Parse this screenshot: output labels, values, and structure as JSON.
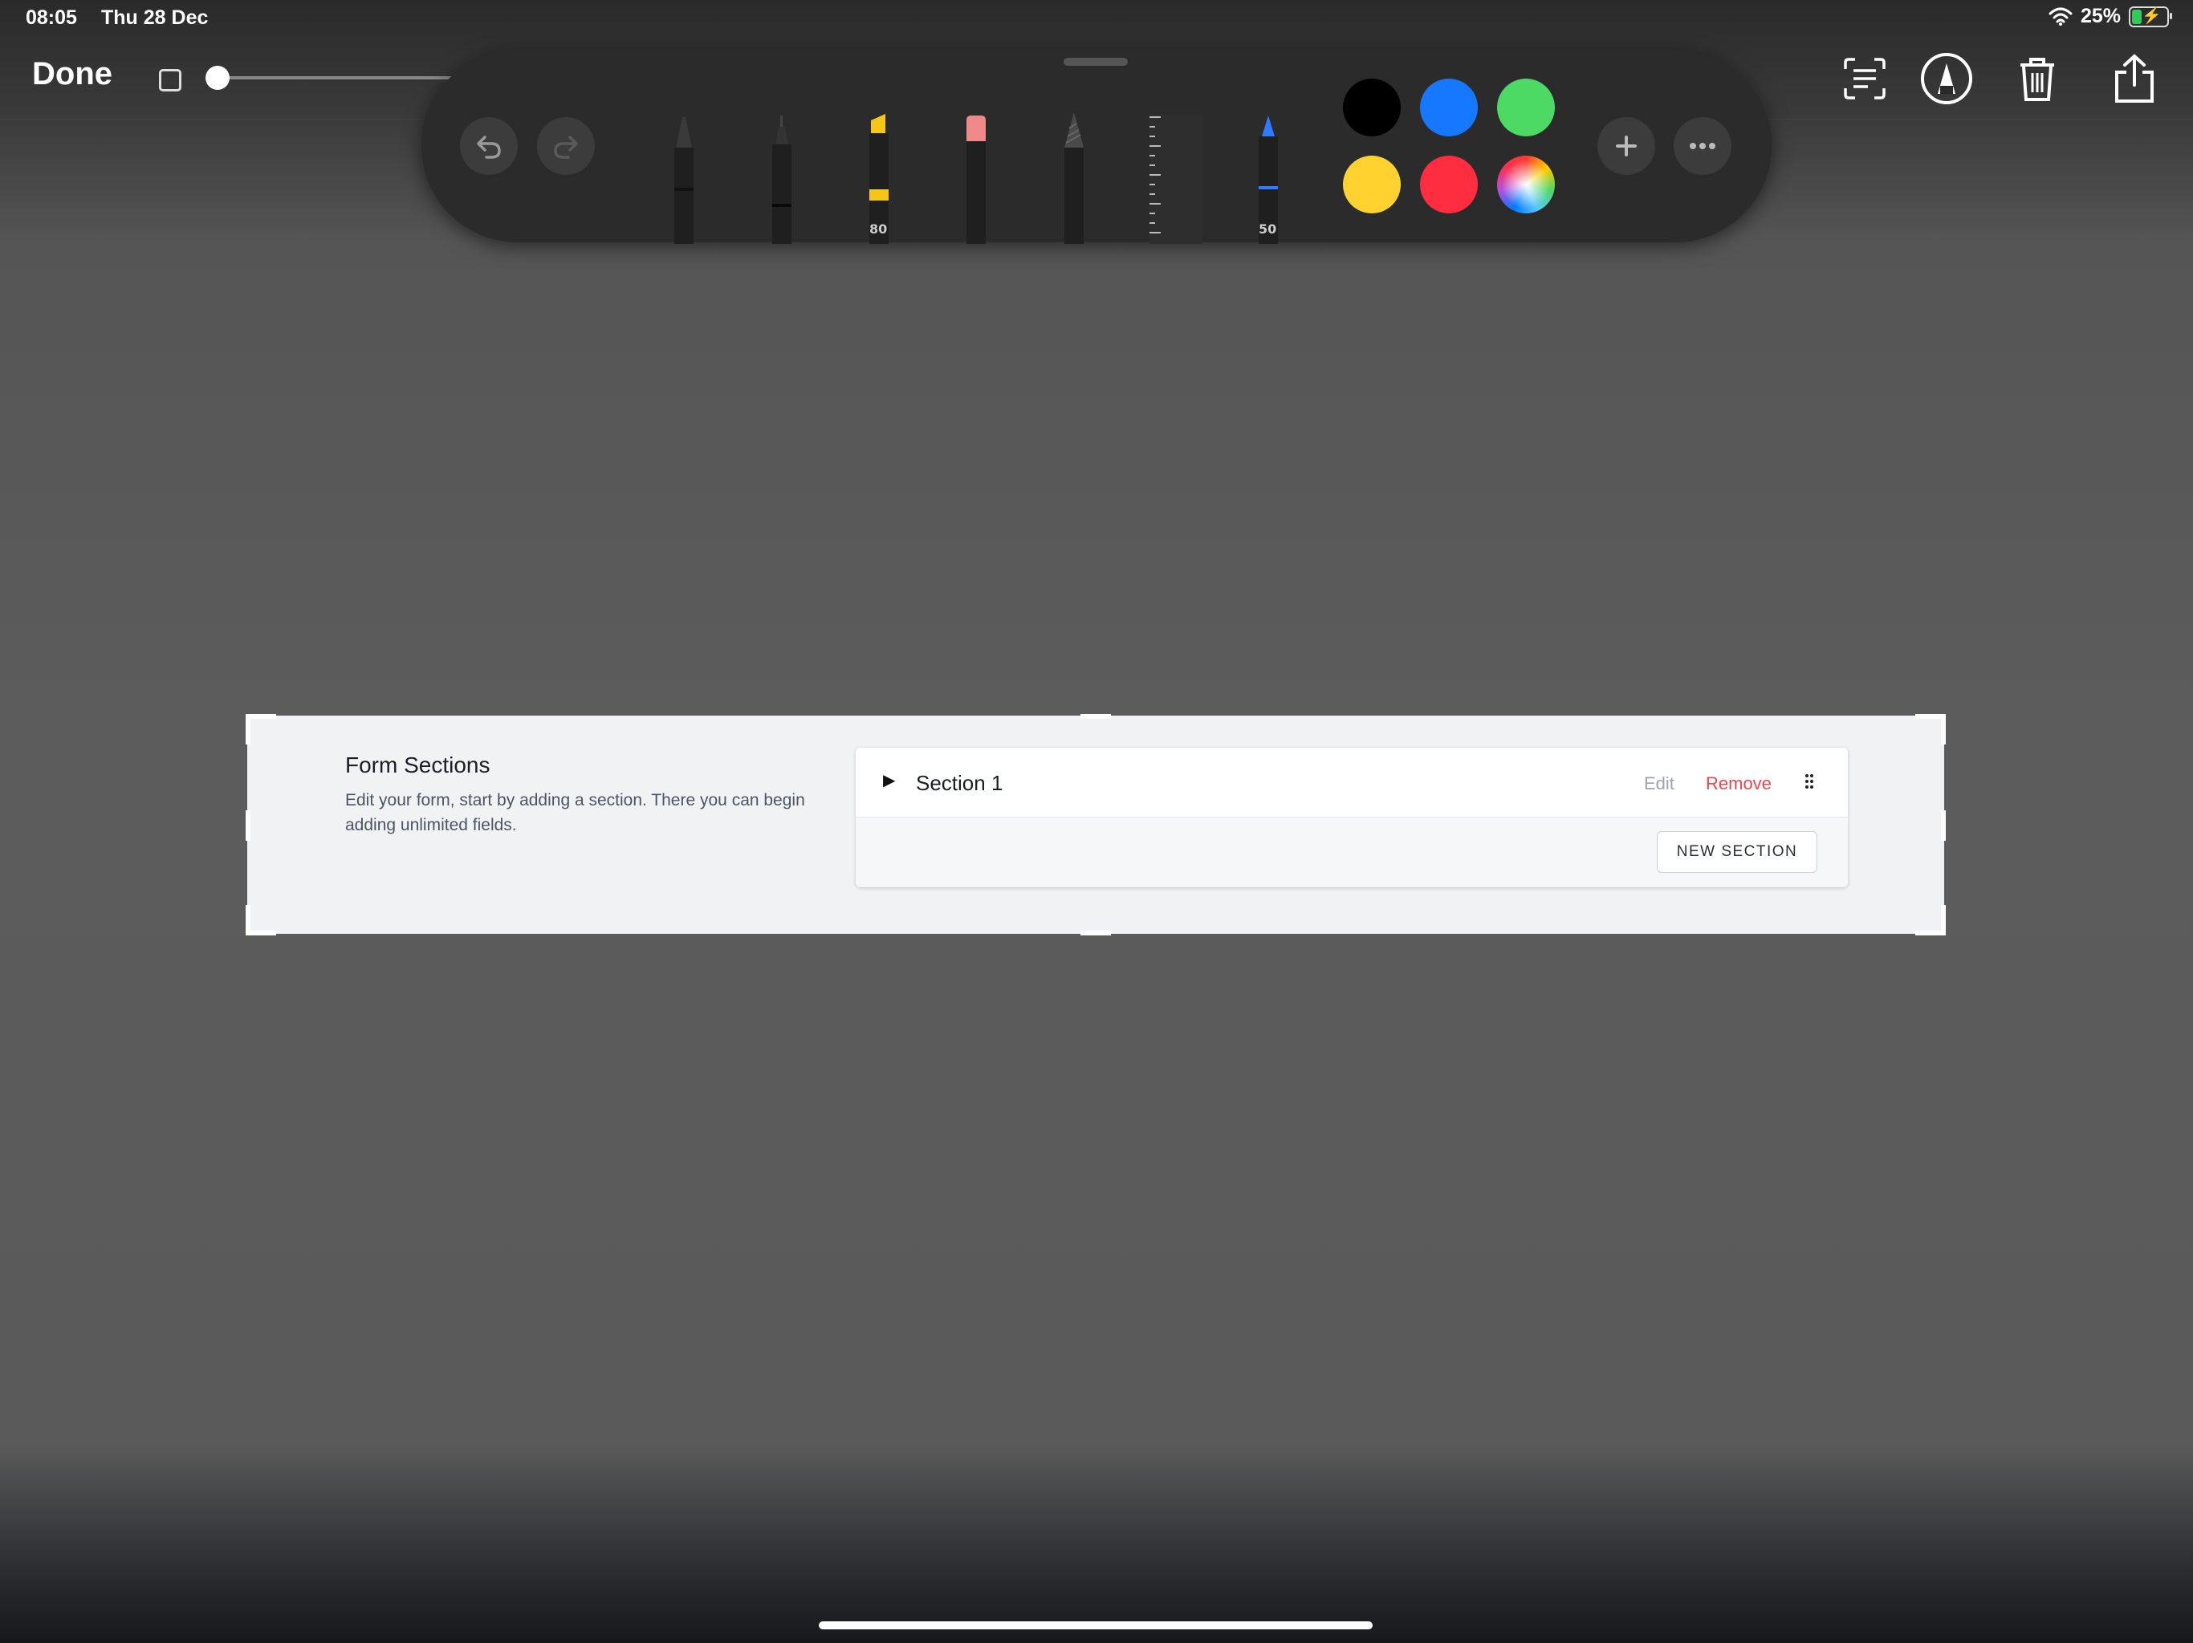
{
  "status_bar": {
    "time": "08:05",
    "date": "Thu 28 Dec",
    "battery": "25%"
  },
  "toolbar": {
    "done_label": "Done"
  },
  "palette": {
    "tools": [
      {
        "name": "pen",
        "label": ""
      },
      {
        "name": "fineliner",
        "label": ""
      },
      {
        "name": "highlighter",
        "label": "80"
      },
      {
        "name": "eraser",
        "label": ""
      },
      {
        "name": "pencil",
        "label": ""
      },
      {
        "name": "ruler",
        "label": ""
      },
      {
        "name": "crayon",
        "label": "50"
      }
    ],
    "colors": [
      "#000000",
      "#1677ff",
      "#4cd964",
      "#ffd230",
      "#ff2d3f",
      "spectrum"
    ]
  },
  "form": {
    "title": "Form Sections",
    "description": "Edit your form, start by adding a section. There you can begin adding unlimited fields.",
    "section": {
      "label": "Section 1",
      "edit_label": "Edit",
      "remove_label": "Remove"
    },
    "new_section_label": "NEW SECTION"
  }
}
